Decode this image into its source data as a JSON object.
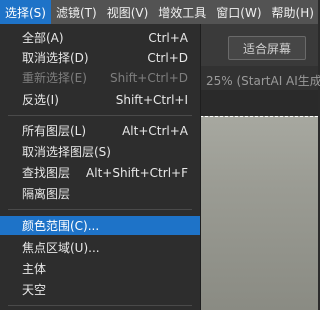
{
  "menubar": {
    "items": [
      {
        "label": "选择(S)"
      },
      {
        "label": "滤镜(T)"
      },
      {
        "label": "视图(V)"
      },
      {
        "label": "增效工具"
      },
      {
        "label": "窗口(W)"
      },
      {
        "label": "帮助(H)"
      }
    ]
  },
  "toolbar": {
    "fit_screen_label": "适合屏幕"
  },
  "document": {
    "tab_text": "25% (StartAI AI生成,"
  },
  "menu": {
    "items": [
      {
        "label": "全部(A)",
        "shortcut": "Ctrl+A"
      },
      {
        "label": "取消选择(D)",
        "shortcut": "Ctrl+D"
      },
      {
        "label": "重新选择(E)",
        "shortcut": "Shift+Ctrl+D"
      },
      {
        "label": "反选(I)",
        "shortcut": "Shift+Ctrl+I"
      },
      {
        "label": "所有图层(L)",
        "shortcut": "Alt+Ctrl+A"
      },
      {
        "label": "取消选择图层(S)",
        "shortcut": ""
      },
      {
        "label": "查找图层",
        "shortcut": "Alt+Shift+Ctrl+F"
      },
      {
        "label": "隔离图层",
        "shortcut": ""
      },
      {
        "label": "颜色范围(C)...",
        "shortcut": ""
      },
      {
        "label": "焦点区域(U)...",
        "shortcut": ""
      },
      {
        "label": "主体",
        "shortcut": ""
      },
      {
        "label": "天空",
        "shortcut": ""
      }
    ]
  },
  "colors": {
    "accent": "#1e73c8",
    "menubar_bg": "#535353",
    "menu_bg": "#2d2d2d",
    "disabled_text": "#7e7e7e"
  }
}
